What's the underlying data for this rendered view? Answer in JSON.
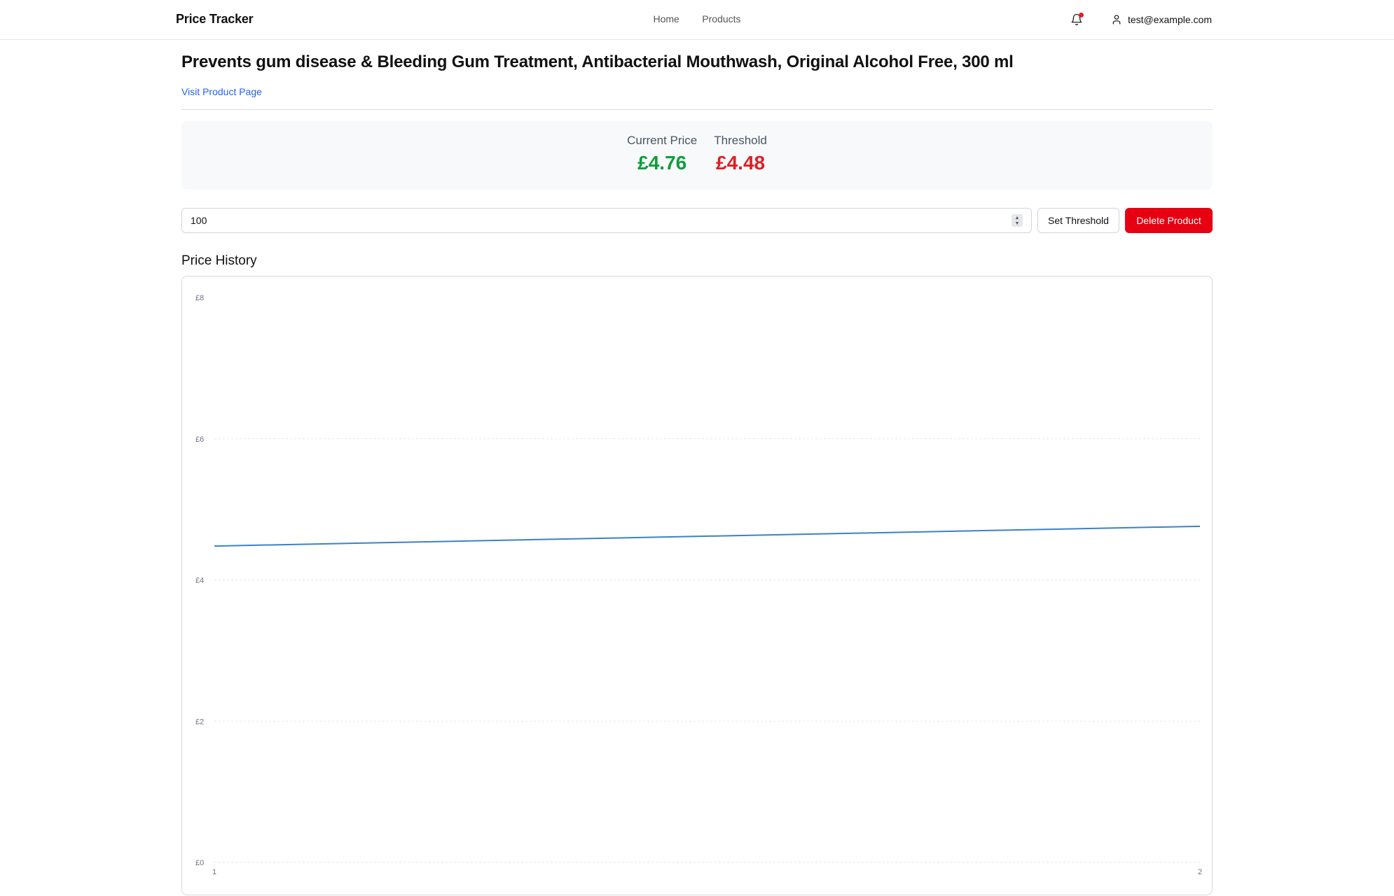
{
  "header": {
    "brand": "Price Tracker",
    "nav": [
      {
        "label": "Home"
      },
      {
        "label": "Products"
      }
    ],
    "notification_icon": "bell-icon",
    "notification_dot_color": "#e11d23",
    "user_icon": "user-icon",
    "user_email": "test@example.com"
  },
  "product": {
    "title": "Prevents gum disease & Bleeding Gum Treatment, Antibacterial Mouthwash, Original Alcohol Free, 300 ml",
    "visit_link": "Visit Product Page"
  },
  "prices": {
    "current_label": "Current Price",
    "current_value": "£4.76",
    "threshold_label": "Threshold",
    "threshold_value": "£4.48",
    "current_color": "#0f9d3c",
    "threshold_color": "#e11d23"
  },
  "controls": {
    "threshold_input_value": "100",
    "set_threshold_label": "Set Threshold",
    "delete_label": "Delete Product",
    "delete_color": "#e60012"
  },
  "history": {
    "title": "Price History"
  },
  "chart_data": {
    "type": "line",
    "x": [
      1,
      2
    ],
    "series": [
      {
        "values": [
          4.48,
          4.76
        ],
        "color": "#3b82c4"
      }
    ],
    "x_tick_labels": [
      "1",
      "2"
    ],
    "y_tick_values": [
      0,
      2,
      4,
      6,
      8
    ],
    "y_tick_labels": [
      "£0",
      "£2",
      "£4",
      "£6",
      "£8"
    ],
    "ylim": [
      0,
      8
    ],
    "grid": true,
    "grid_style": "dashed-horizontal",
    "legend": "none"
  }
}
